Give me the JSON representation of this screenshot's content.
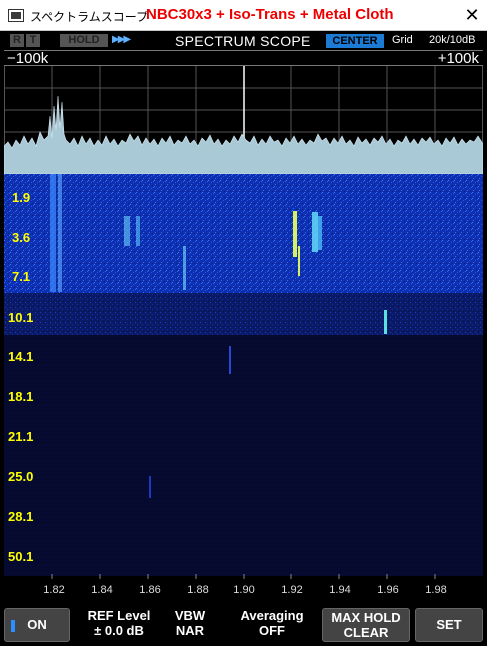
{
  "window": {
    "title": "スペクトラムスコープ",
    "subtitle": "NBC30x3 + Iso-Trans + Metal Cloth",
    "close_glyph": "✕"
  },
  "status": {
    "r": "R",
    "t": "T",
    "hold": "HOLD",
    "arrows": "▶▶▶",
    "scope_title": "SPECTRUM SCOPE",
    "mode": "CENTER",
    "grid": "Grid",
    "span": "20k/10dB"
  },
  "span": {
    "left": "−100k",
    "right": "+100k"
  },
  "waterfall": {
    "row_labels": [
      "1.9",
      "3.6",
      "7.1",
      "10.1",
      "14.1",
      "18.1",
      "21.1",
      "25.0",
      "28.1",
      "50.1"
    ],
    "freq_ticks": [
      "1.82",
      "1.84",
      "1.86",
      "1.88",
      "1.90",
      "1.92",
      "1.94",
      "1.96",
      "1.98"
    ],
    "label_color": "#ffff00"
  },
  "buttons": {
    "on": "ON",
    "ref_level_l1": "REF Level",
    "ref_level_l2": "± 0.0 dB",
    "vbw_l1": "VBW",
    "vbw_l2": "NAR",
    "averaging_l1": "Averaging",
    "averaging_l2": "OFF",
    "maxhold_l1": "MAX HOLD",
    "maxhold_l2": "CLEAR",
    "set": "SET"
  }
}
